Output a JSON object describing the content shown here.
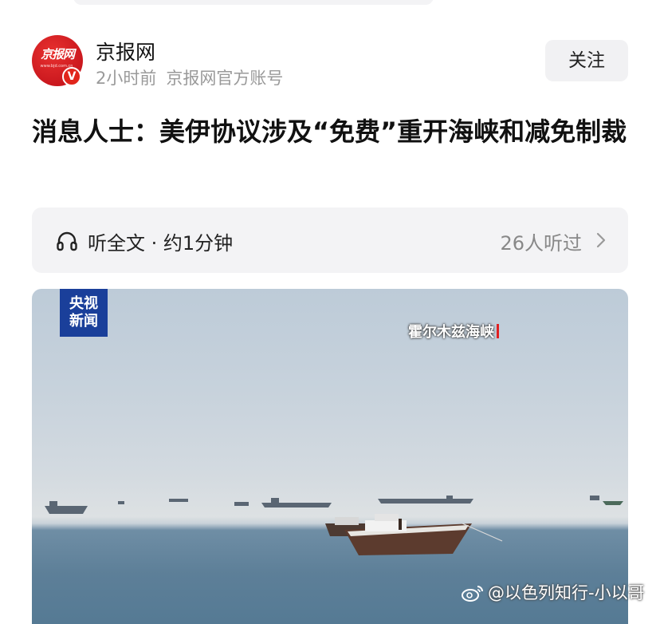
{
  "account": {
    "name": "京报网",
    "time_ago": "2小时前",
    "description": "京报网官方账号",
    "avatar_logo_text": "京报网",
    "avatar_logo_sub": "www.bjd.com.cn",
    "verified_badge": "V",
    "follow_label": "关注"
  },
  "article": {
    "headline": "消息人士：美伊协议涉及“免费”重开海峡和减免制裁"
  },
  "listen": {
    "label": "听全文 · 约1分钟",
    "count": "26人听过",
    "icon": "headphone-icon"
  },
  "image": {
    "logo_line1": "央视",
    "logo_line2": "新闻",
    "caption": "霍尔木兹海峡"
  },
  "watermark": {
    "text": "@以色列知行-小以哥",
    "icon": "weibo-icon"
  },
  "colors": {
    "brand_red": "#c8161d",
    "cctv_blue": "#1a3f9a"
  }
}
